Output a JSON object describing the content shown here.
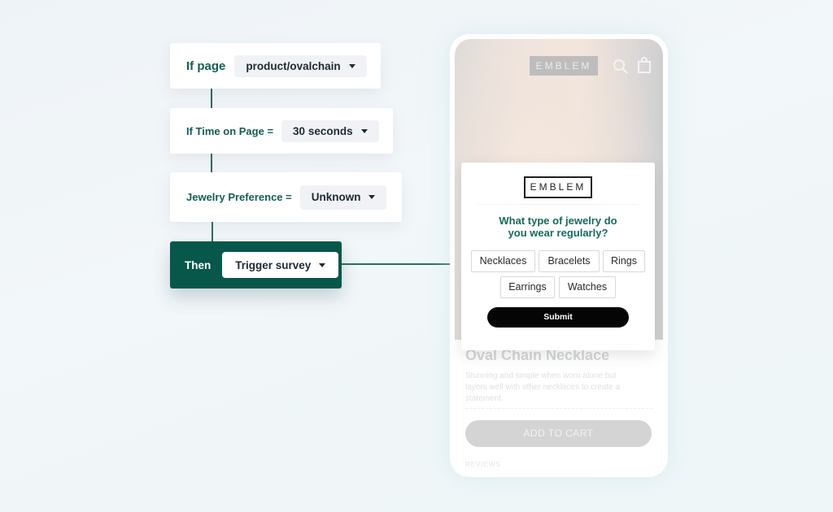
{
  "rule_builder": {
    "conditions": [
      {
        "label": "If page",
        "value": "product/ovalchain"
      },
      {
        "label": "If Time on Page =",
        "value": "30 seconds"
      },
      {
        "label": "Jewelry Preference =",
        "value": "Unknown"
      }
    ],
    "action": {
      "label": "Then",
      "value": "Trigger survey"
    }
  },
  "phone": {
    "brand": "EMBLEM",
    "icons": [
      "search-icon",
      "shopping-bag-icon"
    ],
    "product_title": "Oval Chain Necklace",
    "product_description": "Stunning and simple when worn alone but layers well with other necklaces to create a statement.",
    "add_to_cart_label": "ADD TO CART",
    "reviews_label": "REVIEWS"
  },
  "survey": {
    "brand": "EMBLEM",
    "question_line1": "What type of jewelry do",
    "question_line2": "you wear regularly?",
    "options": [
      "Necklaces",
      "Bracelets",
      "Rings",
      "Earrings",
      "Watches"
    ],
    "submit_label": "Submit"
  },
  "colors": {
    "brand_green": "#07574b",
    "label_green": "#135e52",
    "connector": "#2e6b63",
    "submit_black": "#050505"
  }
}
